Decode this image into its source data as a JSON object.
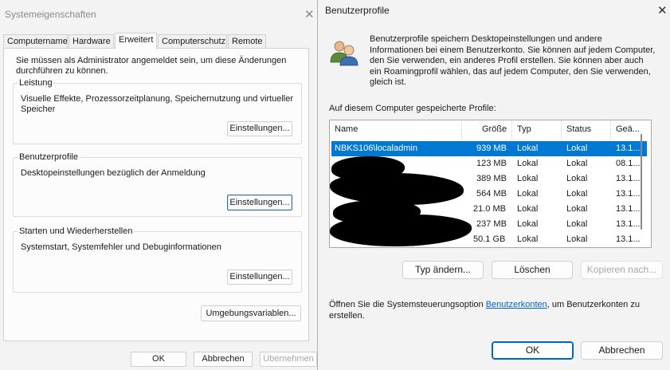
{
  "system_properties": {
    "title": "Systemeigenschaften",
    "close_glyph": "✕",
    "tabs": [
      {
        "label": "Computername",
        "active": false
      },
      {
        "label": "Hardware",
        "active": false
      },
      {
        "label": "Erweitert",
        "active": true
      },
      {
        "label": "Computerschutz",
        "active": false
      },
      {
        "label": "Remote",
        "active": false
      }
    ],
    "intro_text": "Sie müssen als Administrator angemeldet sein, um diese Änderungen durchführen zu können.",
    "groups": [
      {
        "title": "Leistung",
        "text": "Visuelle Effekte, Prozessorzeitplanung, Speichernutzung und virtueller Speicher",
        "button": "Einstellungen..."
      },
      {
        "title": "Benutzerprofile",
        "text": "Desktopeinstellungen bezüglich der Anmeldung",
        "button": "Einstellungen..."
      },
      {
        "title": "Starten und Wiederherstellen",
        "text": "Systemstart, Systemfehler und Debuginformationen",
        "button": "Einstellungen..."
      }
    ],
    "env_button": "Umgebungsvariablen...",
    "ok_button": "OK",
    "cancel_button": "Abbrechen",
    "apply_button": "Übernehmen"
  },
  "user_profiles": {
    "title": "Benutzerprofile",
    "close_glyph": "✕",
    "icon": "users-icon",
    "description": "Benutzerprofile speichern Desktopeinstellungen und andere Informationen bei einem Benutzerkonto. Sie können auf jedem Computer, den Sie verwenden, ein anderes Profil erstellen. Sie können aber auch ein Roamingprofil wählen, das auf jedem Computer, den Sie verwenden, gleich ist.",
    "list_label": "Auf diesem Computer gespeicherte Profile:",
    "columns": [
      "Name",
      "Größe",
      "Typ",
      "Status",
      "Geä..."
    ],
    "rows": [
      {
        "name": "NBKS106\\localadmin",
        "size": "939 MB",
        "type": "Lokal",
        "status": "Lokal",
        "changed": "13.1...",
        "selected": true
      },
      {
        "name": "",
        "size": "123 MB",
        "type": "Lokal",
        "status": "Lokal",
        "changed": "08.1...",
        "selected": false
      },
      {
        "name": "",
        "size": "389 MB",
        "type": "Lokal",
        "status": "Lokal",
        "changed": "13.1...",
        "selected": false
      },
      {
        "name": "",
        "size": "564 MB",
        "type": "Lokal",
        "status": "Lokal",
        "changed": "13.1...",
        "selected": false
      },
      {
        "name": "",
        "size": "21.0 MB",
        "type": "Lokal",
        "status": "Lokal",
        "changed": "13.1...",
        "selected": false
      },
      {
        "name": "",
        "size": "237 MB",
        "type": "Lokal",
        "status": "Lokal",
        "changed": "13.1...",
        "selected": false
      },
      {
        "name": "",
        "size": "50.1 GB",
        "type": "Lokal",
        "status": "Lokal",
        "changed": "13.1...",
        "selected": false
      }
    ],
    "buttons": {
      "change_type": "Typ ändern...",
      "delete": "Löschen",
      "copy_to": "Kopieren nach..."
    },
    "footer_prefix": "Öffnen Sie die Systemsteuerungsoption ",
    "footer_link": "Benutzerkonten",
    "footer_suffix": ", um Benutzerkonten zu erstellen.",
    "ok_button": "OK",
    "cancel_button": "Abbrechen"
  }
}
